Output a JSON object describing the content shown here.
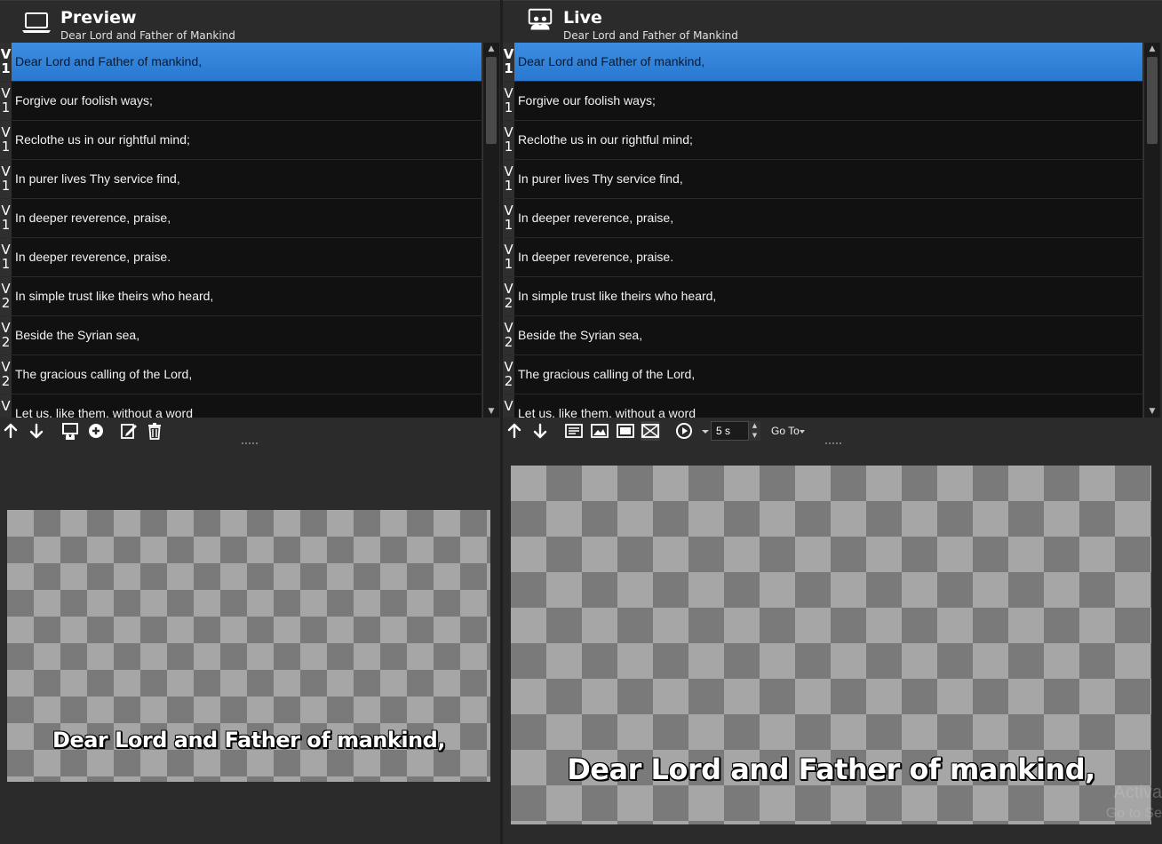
{
  "preview": {
    "title": "Preview",
    "subtitle": "Dear Lord and Father of Mankind",
    "display_text": "Dear Lord and Father of mankind,"
  },
  "live": {
    "title": "Live",
    "subtitle": "Dear Lord and Father of Mankind",
    "display_text": "Dear Lord and Father of mankind,",
    "delay_value": "5 s",
    "goto_label": "Go To"
  },
  "slides": [
    {
      "tag_letter": "V",
      "tag_number": "1",
      "text": "Dear Lord and Father of mankind,"
    },
    {
      "tag_letter": "V",
      "tag_number": "1",
      "text": "Forgive our foolish ways;"
    },
    {
      "tag_letter": "V",
      "tag_number": "1",
      "text": "Reclothe us in our rightful mind;"
    },
    {
      "tag_letter": "V",
      "tag_number": "1",
      "text": "In purer lives Thy service find,"
    },
    {
      "tag_letter": "V",
      "tag_number": "1",
      "text": "In deeper reverence, praise,"
    },
    {
      "tag_letter": "V",
      "tag_number": "1",
      "text": "In deeper reverence, praise."
    },
    {
      "tag_letter": "V",
      "tag_number": "2",
      "text": "In simple trust like theirs who heard,"
    },
    {
      "tag_letter": "V",
      "tag_number": "2",
      "text": "Beside the Syrian sea,"
    },
    {
      "tag_letter": "V",
      "tag_number": "2",
      "text": "The gracious calling of the Lord,"
    },
    {
      "tag_letter": "V",
      "tag_number": "",
      "text": "Let us, like them, without a word"
    }
  ],
  "watermark": {
    "line1": "Activa",
    "line2": "Go to Se"
  },
  "icons": {
    "preview_header": "laptop-icon",
    "live_header": "monitor-audience-icon"
  },
  "colors": {
    "selected_row": "#2f80d9",
    "list_background": "#111111",
    "panel_background": "#2b2b2b"
  }
}
